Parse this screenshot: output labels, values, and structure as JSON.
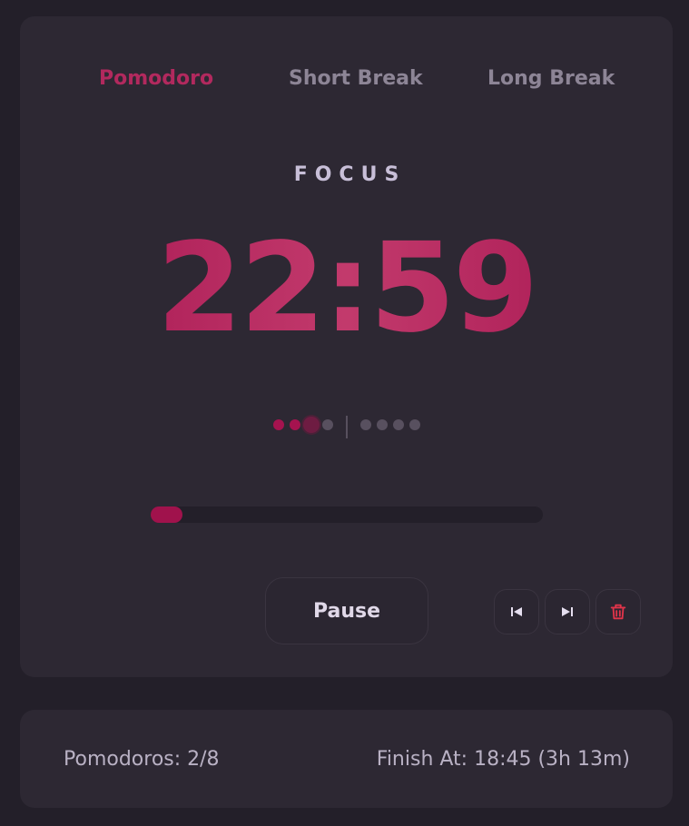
{
  "tabs": [
    {
      "label": "Pomodoro",
      "active": true
    },
    {
      "label": "Short Break",
      "active": false
    },
    {
      "label": "Long Break",
      "active": false
    }
  ],
  "mode_label": "FOCUS",
  "timer": "22:59",
  "session_dots": {
    "group1": [
      "done",
      "done",
      "current",
      "pending"
    ],
    "group2": [
      "pending",
      "pending",
      "pending",
      "pending"
    ]
  },
  "progress_fraction": 0.08,
  "controls": {
    "pause_label": "Pause",
    "prev_icon": "skip-previous-icon",
    "next_icon": "skip-next-icon",
    "delete_icon": "trash-icon"
  },
  "footer": {
    "pomodoros": "Pomodoros: 2/8",
    "finish_at": "Finish At: 18:45 (3h 13m)"
  },
  "colors": {
    "accent": "#a5134f",
    "background": "#231f29",
    "card": "#2d2833",
    "delete": "#e0344a"
  }
}
